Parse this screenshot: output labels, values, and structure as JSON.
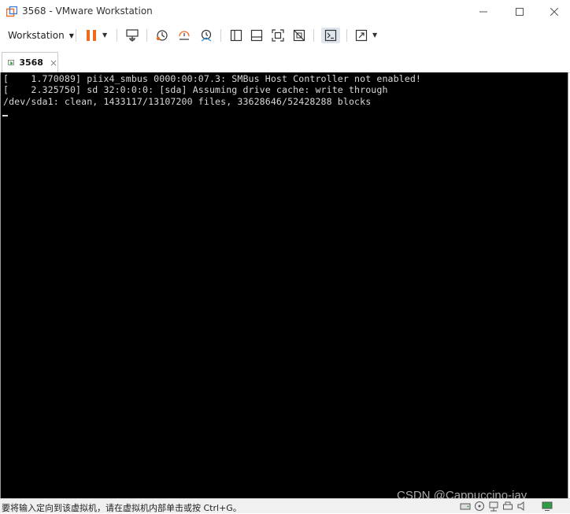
{
  "window": {
    "title": "3568 - VMware Workstation",
    "controls": {
      "minimize": "—",
      "maximize": "☐",
      "close": "✕"
    }
  },
  "toolbar": {
    "workstation_menu": "Workstation",
    "buttons": [
      "pause-icon",
      "send-ctrl-alt-del-icon",
      "snapshot-icon",
      "revert-snapshot-icon",
      "snapshot-manager-icon",
      "show-library-icon",
      "thumbnail-bar-icon",
      "full-screen-icon",
      "unity-icon",
      "console-view-icon",
      "stretch-guest-icon"
    ]
  },
  "tabs": [
    {
      "label": "3568",
      "close": "×"
    }
  ],
  "console": {
    "lines": [
      "[    1.770089] piix4_smbus 0000:00:07.3: SMBus Host Controller not enabled!",
      "[    2.325750] sd 32:0:0:0: [sda] Assuming drive cache: write through",
      "/dev/sda1: clean, 1433117/13107200 files, 33628646/52428288 blocks"
    ]
  },
  "statusbar": {
    "message": "要将输入定向到该虚拟机，请在虚拟机内部单击或按 Ctrl+G。",
    "devices": [
      "hard-disk-icon",
      "cd-dvd-icon",
      "network-icon",
      "printer-icon",
      "sound-icon",
      "display-icon"
    ]
  },
  "watermark": "CSDN @Cappuccino-jay",
  "colors": {
    "accent_orange": "#f06a1e",
    "vmware_green": "#2f9e44",
    "console_bg": "#000000",
    "console_text": "#d8d8d8"
  }
}
